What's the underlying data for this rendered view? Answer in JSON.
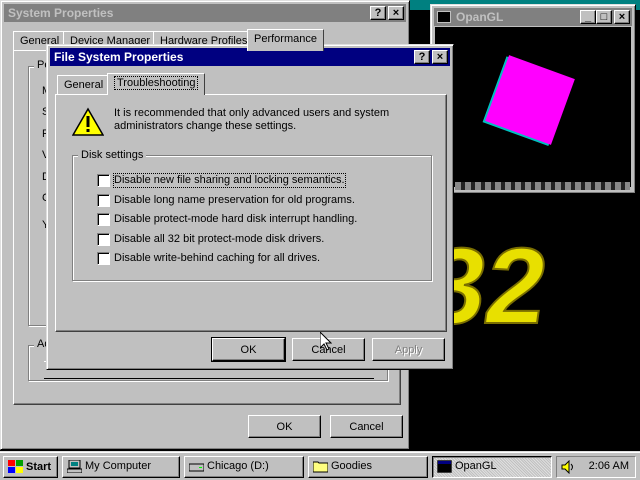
{
  "desktop": {
    "background": "#000000",
    "accent_teal": "#008080"
  },
  "opengl_window": {
    "title": "OpanGL",
    "buttons": {
      "minimize": "_",
      "maximize": "□",
      "close": "×"
    },
    "cube_color": "#ff00ff",
    "text_color": "#e8e000",
    "text": "32"
  },
  "system_properties": {
    "title": "System Properties",
    "help_btn": "?",
    "close_btn": "×",
    "tabs": [
      "General",
      "Device Manager",
      "Hardware Profiles",
      "Performance"
    ],
    "group_initial": "Pe",
    "side_letters": [
      "M",
      "S",
      "F",
      "V",
      "D",
      "C",
      "Y"
    ],
    "lower_group_initial": "Ad",
    "ok_label": "OK",
    "cancel_label": "Cancel"
  },
  "fs_properties": {
    "title": "File System Properties",
    "help_btn": "?",
    "close_btn": "×",
    "tabs": [
      "General",
      "Troubleshooting"
    ],
    "warning_icon": "warning-icon",
    "warning_text": "It is recommended that only advanced users and system administrators change these settings.",
    "group_label": "Disk settings",
    "options": [
      {
        "label": "Disable new file sharing and locking semantics.",
        "checked": false
      },
      {
        "label": "Disable long name preservation for old programs.",
        "checked": false
      },
      {
        "label": "Disable protect-mode hard disk interrupt handling.",
        "checked": false
      },
      {
        "label": "Disable all 32 bit protect-mode disk drivers.",
        "checked": false
      },
      {
        "label": "Disable write-behind caching for all drives.",
        "checked": false
      }
    ],
    "ok_label": "OK",
    "cancel_label": "Cancel",
    "apply_label": "Apply"
  },
  "taskbar": {
    "start_label": "Start",
    "items": [
      {
        "label": "My Computer",
        "icon": "computer-icon"
      },
      {
        "label": "Chicago (D:)",
        "icon": "drive-icon"
      },
      {
        "label": "Goodies",
        "icon": "folder-icon"
      },
      {
        "label": "OpanGL",
        "icon": "window-icon"
      }
    ],
    "tray_icon": "speaker-icon",
    "clock": "2:06 AM"
  }
}
